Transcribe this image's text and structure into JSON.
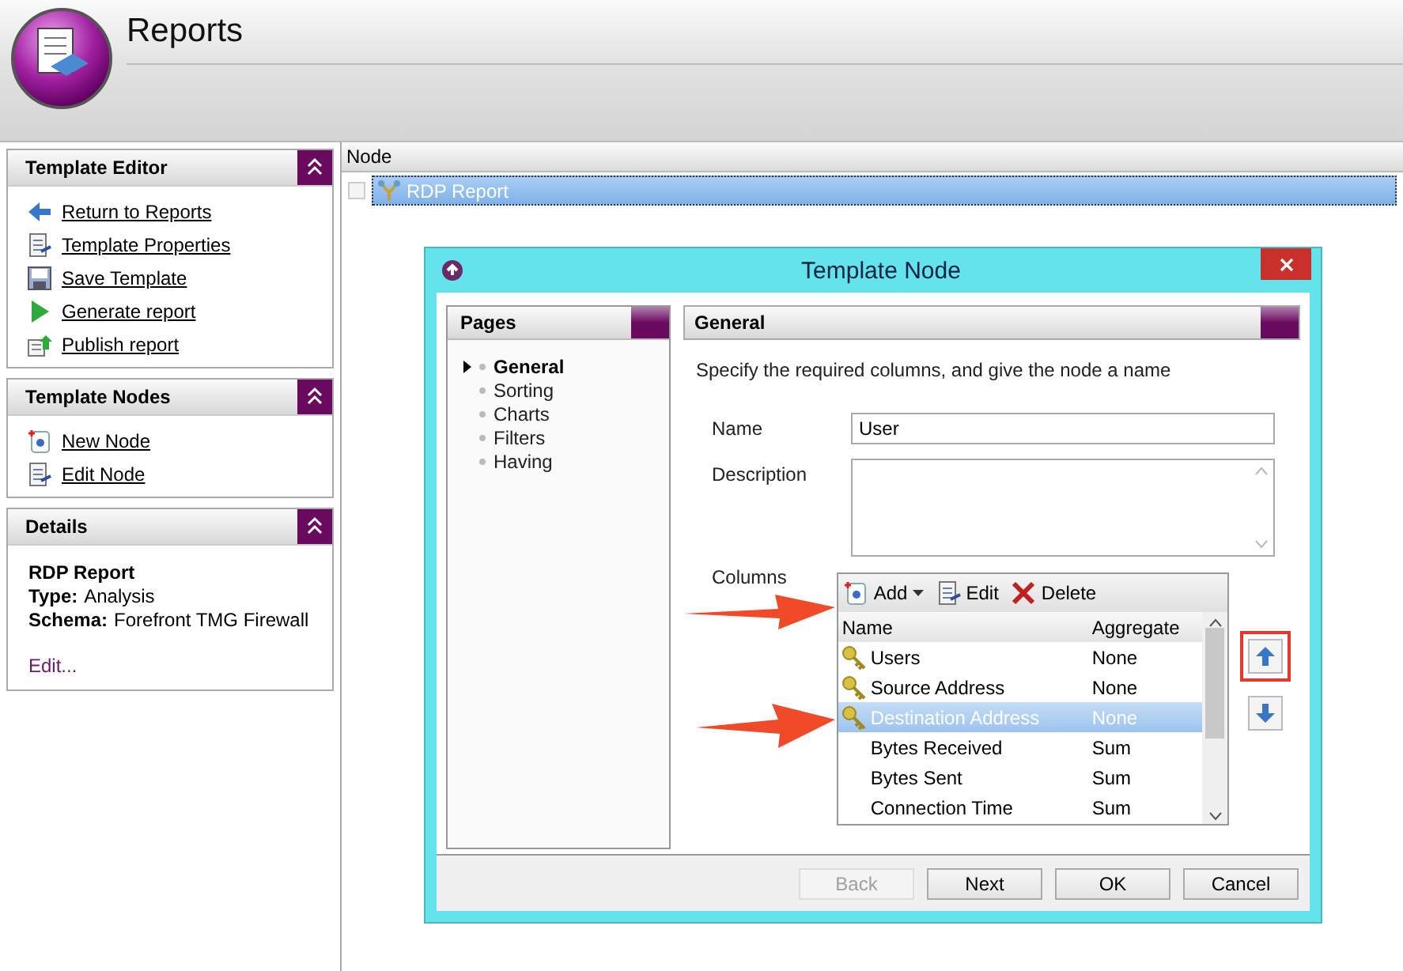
{
  "app": {
    "title": "Reports"
  },
  "sidebar": {
    "panels": [
      {
        "kind": "links",
        "title": "Template Editor",
        "links": [
          {
            "label": "Return to Reports",
            "kind": "back"
          },
          {
            "label": "Template Properties",
            "kind": "document"
          },
          {
            "label": "Save Template",
            "kind": "save"
          },
          {
            "label": "Generate report",
            "kind": "play"
          },
          {
            "label": "Publish report",
            "kind": "publish"
          }
        ]
      },
      {
        "kind": "links",
        "title": "Template Nodes",
        "links": [
          {
            "label": "New Node",
            "kind": "new"
          },
          {
            "label": "Edit Node",
            "kind": "document"
          }
        ]
      },
      {
        "kind": "details",
        "title": "Details",
        "name": "RDP Report",
        "fields": [
          {
            "label": "Type:",
            "value": "Analysis"
          },
          {
            "label": "Schema:",
            "value": "Forefront TMG Firewall"
          }
        ],
        "link": "Edit..."
      }
    ]
  },
  "tree": {
    "column": "Node",
    "items": [
      {
        "label": "RDP Report",
        "selected": true
      }
    ]
  },
  "dialog": {
    "title": "Template Node",
    "pages": {
      "title": "Pages",
      "items": [
        {
          "label": "General",
          "selected": true
        },
        {
          "label": "Sorting",
          "selected": false
        },
        {
          "label": "Charts",
          "selected": false
        },
        {
          "label": "Filters",
          "selected": false
        },
        {
          "label": "Having",
          "selected": false
        }
      ]
    },
    "section": {
      "title": "General",
      "instructions": "Specify the required columns, and give the node a name",
      "name_label": "Name",
      "name_value": "User",
      "description_label": "Description",
      "columns_label": "Columns",
      "toolbar": [
        {
          "label": "Add",
          "kind": "new",
          "dropdown": true
        },
        {
          "label": "Edit",
          "kind": "edit",
          "dropdown": false
        },
        {
          "label": "Delete",
          "kind": "delete",
          "dropdown": false
        }
      ],
      "table": {
        "columns": [
          "Name",
          "Aggregate"
        ],
        "rows": [
          {
            "name": "Users",
            "aggregate": "None",
            "key": true,
            "selected": false
          },
          {
            "name": "Source Address",
            "aggregate": "None",
            "key": true,
            "selected": false
          },
          {
            "name": "Destination Address",
            "aggregate": "None",
            "key": true,
            "selected": true
          },
          {
            "name": "Bytes Received",
            "aggregate": "Sum",
            "key": false,
            "selected": false
          },
          {
            "name": "Bytes Sent",
            "aggregate": "Sum",
            "key": false,
            "selected": false
          },
          {
            "name": "Connection Time",
            "aggregate": "Sum",
            "key": false,
            "selected": false
          }
        ]
      },
      "move_buttons": [
        {
          "highlighted": true
        },
        {
          "highlighted": false
        }
      ]
    },
    "buttons": [
      {
        "label": "Back",
        "disabled": true
      },
      {
        "label": "Next",
        "disabled": false
      },
      {
        "label": "OK",
        "disabled": false
      },
      {
        "label": "Cancel",
        "disabled": false
      }
    ]
  }
}
